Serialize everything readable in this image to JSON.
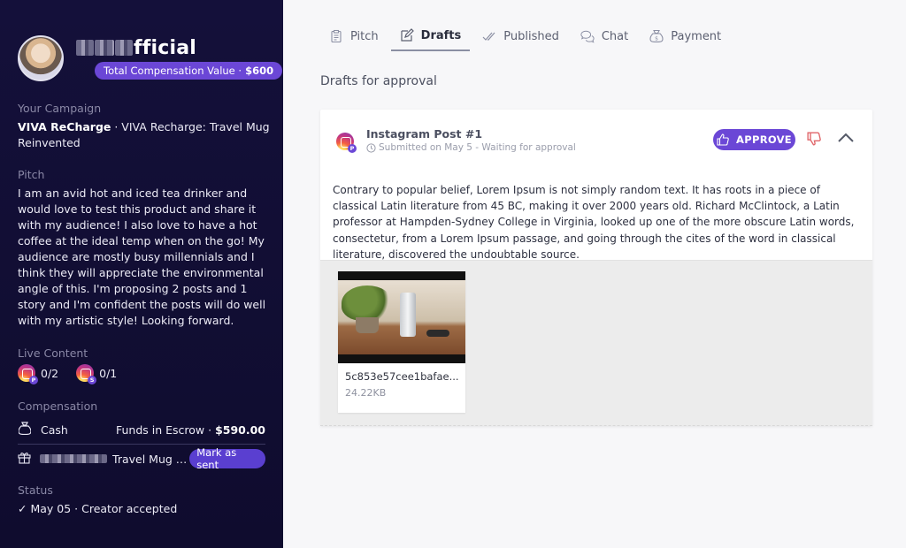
{
  "sidebar": {
    "username_visible": "fficial",
    "compensation_badge": {
      "label": "Total Compensation Value ·",
      "value": "$600"
    },
    "campaign": {
      "label": "Your Campaign",
      "brand": "VIVA ReCharge",
      "text": " · VIVA Recharge: Travel Mug Reinvented"
    },
    "pitch": {
      "label": "Pitch",
      "text": "I am an avid hot and iced tea drinker and would love to test this product and share it with my audience! I also love to have a hot coffee at the ideal temp when on the go! My audience are mostly busy millennials and I think they will appreciate the environmental angle of this. I'm proposing 2 posts and 1 story and I'm confident the posts will do well with my artistic style! Looking forward."
    },
    "live_content": {
      "label": "Live Content",
      "items": [
        {
          "badge": "P",
          "count": "0/2"
        },
        {
          "badge": "S",
          "count": "0/1"
        }
      ]
    },
    "compensation": {
      "label": "Compensation",
      "cash_label": "Cash",
      "cash_status": "Funds in Escrow ·",
      "cash_amount": "$590.00",
      "product_name": "Travel Mug R...",
      "mark_sent_label": "Mark as sent"
    },
    "status": {
      "label": "Status",
      "text": "May 05 · Creator accepted"
    }
  },
  "tabs": [
    {
      "label": "Pitch",
      "icon": "clipboard-icon"
    },
    {
      "label": "Drafts",
      "icon": "pencil-icon"
    },
    {
      "label": "Published",
      "icon": "double-check-icon"
    },
    {
      "label": "Chat",
      "icon": "chat-bubbles-icon"
    },
    {
      "label": "Payment",
      "icon": "money-bag-icon"
    }
  ],
  "active_tab": "Drafts",
  "main": {
    "title": "Drafts for approval",
    "card": {
      "title": "Instagram Post #1",
      "subtitle": "Submitted on May 5 - Waiting for approval",
      "approve_label": "APPROVE",
      "body": "Contrary to popular belief, Lorem Ipsum is not simply random text. It has roots in a piece of classical Latin literature from 45 BC, making it over 2000 years old. Richard McClintock, a Latin professor at Hampden-Sydney College in Virginia, looked up one of the more obscure Latin words, consectetur, from a Lorem Ipsum passage, and going through the cites of the word in classical literature, discovered the undoubtable source.",
      "attachment": {
        "name": "5c853e57cee1bafae...",
        "size": "24.22KB"
      }
    }
  },
  "colors": {
    "sidebar_bg": "#14103a",
    "accent": "#6b47d6",
    "reject": "#e0666a"
  }
}
